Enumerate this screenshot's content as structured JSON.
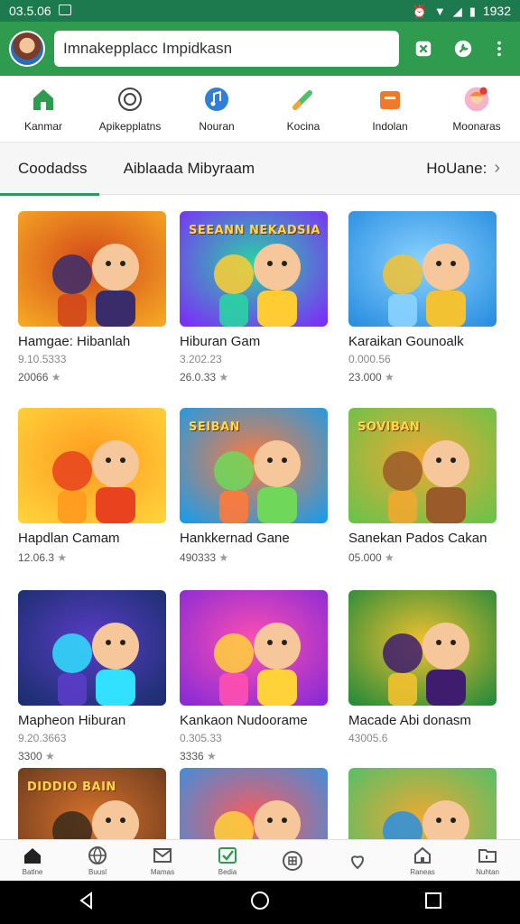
{
  "status_bar": {
    "time": "03.5.06",
    "clock_right": "1932"
  },
  "app_bar": {
    "search_value": "Imnakepplacc Impidkasn"
  },
  "categories": [
    {
      "label": "Kanmar",
      "icon": "home-icon"
    },
    {
      "label": "Apikepplatns",
      "icon": "compass-icon"
    },
    {
      "label": "Nouran",
      "icon": "music-icon"
    },
    {
      "label": "Kocina",
      "icon": "pencil-icon"
    },
    {
      "label": "Indolan",
      "icon": "briefcase-icon"
    },
    {
      "label": "Moonaras",
      "icon": "profile-icon"
    }
  ],
  "tabs": {
    "active": "Coodadss",
    "second": "Aiblaada Mibyraam",
    "more": "HoUane:"
  },
  "cards": [
    {
      "title": "Hamgae: Hibanlah",
      "meta": "9.10.5333",
      "rating": "20066",
      "badge": ""
    },
    {
      "title": "Hiburan Gam",
      "meta": "3.202.23",
      "rating": "26.0.33",
      "badge": "SEEANN NEKADSIA"
    },
    {
      "title": "Karaikan Gounoalk",
      "meta": "0.000.56",
      "rating": "23.000",
      "badge": ""
    },
    {
      "title": "Hapdlan Camam",
      "meta": "",
      "rating": "12.06.3",
      "badge": ""
    },
    {
      "title": "Hankkernad Gane",
      "meta": "",
      "rating": "490333",
      "badge": "SEIBAN"
    },
    {
      "title": "Sanekan Pados Cakan",
      "meta": "",
      "rating": "05.000",
      "badge": "SOVIBAN"
    },
    {
      "title": "Mapheon Hiburan",
      "meta": "9.20.3663",
      "rating": "3300",
      "badge": ""
    },
    {
      "title": "Kankaon Nudoorame",
      "meta": "0.305.33",
      "rating": "3336",
      "badge": ""
    },
    {
      "title": "Macade Abi donasm",
      "meta": "43005.6",
      "rating": "",
      "badge": ""
    },
    {
      "title": "",
      "meta": "",
      "rating": "",
      "badge": "DIDDIO BAIN"
    },
    {
      "title": "",
      "meta": "",
      "rating": "",
      "badge": ""
    },
    {
      "title": "",
      "meta": "",
      "rating": "",
      "badge": ""
    }
  ],
  "bottom_nav": [
    {
      "label": "Batlne",
      "icon": "home-icon"
    },
    {
      "label": "Buusl",
      "icon": "globe-icon"
    },
    {
      "label": "Mamas",
      "icon": "mail-icon"
    },
    {
      "label": "Bedia",
      "icon": "check-icon"
    },
    {
      "label": "",
      "icon": "grid-circle-icon"
    },
    {
      "label": "",
      "icon": "heart-icon"
    },
    {
      "label": "Raneas",
      "icon": "house-icon"
    },
    {
      "label": "Nuhtan",
      "icon": "folder-icon"
    }
  ],
  "colors": {
    "primary": "#2e9b4f",
    "status": "#1d7a4e"
  }
}
